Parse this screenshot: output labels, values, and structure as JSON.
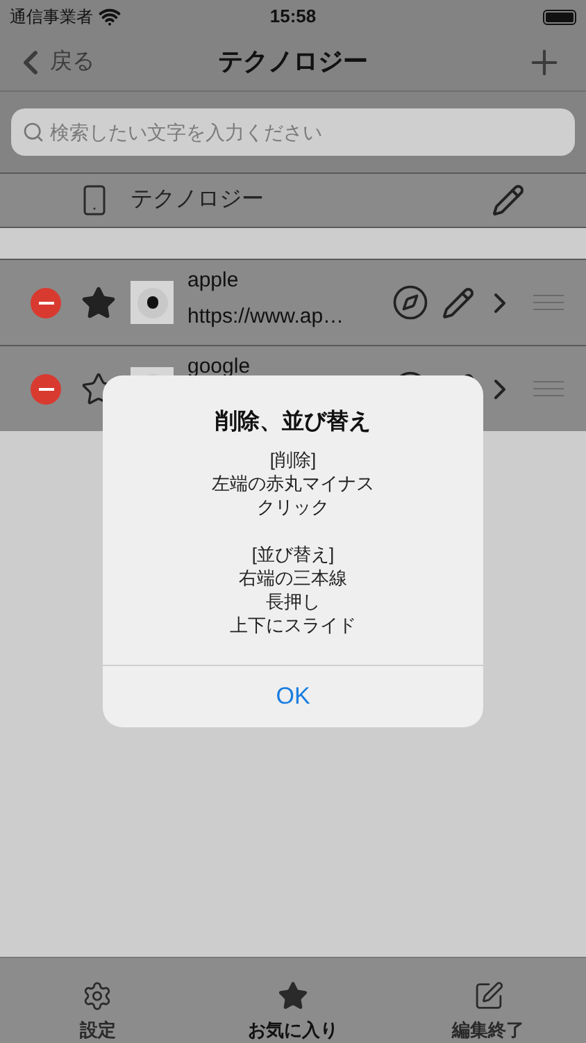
{
  "status_bar": {
    "carrier": "通信事業者",
    "time": "15:58"
  },
  "nav": {
    "back": "戻る",
    "title": "テクノロジー"
  },
  "search": {
    "placeholder": "検索したい文字を入力ください"
  },
  "category": {
    "name": "テクノロジー"
  },
  "bookmarks": [
    {
      "title": "apple",
      "url": "https://www.ap…",
      "favorite": true
    },
    {
      "title": "google",
      "favorite": false
    }
  ],
  "alert": {
    "title": "削除、並び替え",
    "message": [
      [
        "[削除]",
        "左端の赤丸マイナス",
        "クリック"
      ],
      [
        "[並び替え]",
        "右端の三本線",
        "長押し",
        "上下にスライド"
      ]
    ],
    "button": "OK"
  },
  "tab_bar": [
    {
      "kind": "settings",
      "label": "設定",
      "selected": false
    },
    {
      "kind": "favorites",
      "label": "お気に入り",
      "selected": true
    },
    {
      "kind": "edit",
      "label": "編集終了",
      "selected": false
    }
  ]
}
